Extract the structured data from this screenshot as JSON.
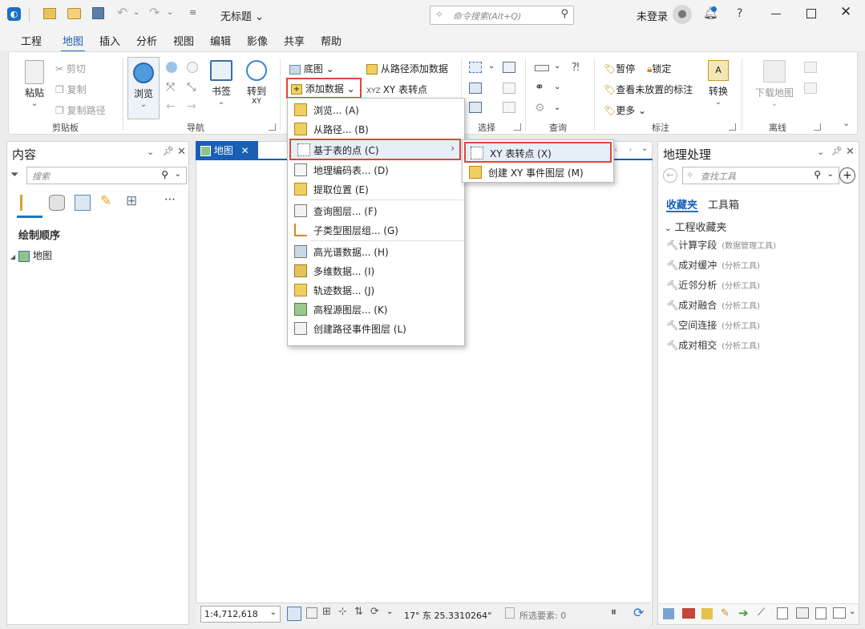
{
  "titlebar": {
    "doc_title": "无标题",
    "search_placeholder": "命令搜索(Alt+Q)",
    "user_label": "未登录",
    "help": "?"
  },
  "ribbon_tabs": [
    "工程",
    "地图",
    "插入",
    "分析",
    "视图",
    "编辑",
    "影像",
    "共享",
    "帮助"
  ],
  "active_tab": "地图",
  "ribbon": {
    "clipboard": {
      "paste": "粘贴",
      "cut": "剪切",
      "copy": "复制",
      "copy_path": "复制路径",
      "label": "剪贴板"
    },
    "navigate": {
      "explore": "浏览",
      "bookmarks": "书签",
      "goto": "转到",
      "goto_sub": "XY",
      "label": "导航"
    },
    "layer": {
      "basemap": "底图",
      "add_data": "添加数据",
      "add_from_path": "从路径添加数据",
      "xy_to_point": "XY 表转点"
    },
    "selection": {
      "label": "选择"
    },
    "inquiry": {
      "label": "查询"
    },
    "labeling": {
      "pause": "暂停",
      "lock": "锁定",
      "unplaced": "查看未放置的标注",
      "more": "更多",
      "convert": "转换",
      "label": "标注"
    },
    "offline": {
      "download": "下载地图",
      "label": "离线"
    }
  },
  "contents": {
    "title": "内容",
    "search_placeholder": "搜索",
    "draw_order": "绘制顺序",
    "map_item": "地图"
  },
  "map_view": {
    "tab_label": "地图"
  },
  "add_data_menu": {
    "items": [
      {
        "label": "浏览...  (A)",
        "icon": "browse-icon"
      },
      {
        "label": "从路径...  (B)",
        "icon": "add-from-path-icon"
      },
      {
        "label": "基于表的点  (C)",
        "icon": "points-from-table-icon",
        "submenu": true
      },
      {
        "label": "地理编码表...  (D)",
        "icon": "geocode-table-icon"
      },
      {
        "label": "提取位置  (E)",
        "icon": "extract-locations-icon"
      },
      {
        "label": "查询图层...  (F)",
        "icon": "query-layer-icon"
      },
      {
        "label": "子类型图层组...  (G)",
        "icon": "subtype-group-icon"
      },
      {
        "label": "高光谱数据...  (H)",
        "icon": "hyperspectral-icon"
      },
      {
        "label": "多维数据...  (I)",
        "icon": "multidimensional-icon"
      },
      {
        "label": "轨迹数据...  (J)",
        "icon": "trajectory-icon"
      },
      {
        "label": "高程源图层...  (K)",
        "icon": "elevation-source-icon"
      },
      {
        "label": "创建路径事件图层  (L)",
        "icon": "route-event-icon"
      }
    ]
  },
  "points_submenu": {
    "items": [
      {
        "label": "XY 表转点  (X)",
        "icon": "xy-table-to-point-icon"
      },
      {
        "label": "创建 XY 事件图层  (M)",
        "icon": "xy-event-layer-icon"
      }
    ]
  },
  "geoprocessing": {
    "title": "地理处理",
    "search_placeholder": "查找工具",
    "tab_favorites": "收藏夹",
    "tab_toolboxes": "工具箱",
    "section": "工程收藏夹",
    "tools": [
      {
        "name": "计算字段",
        "box": "(数据管理工具)"
      },
      {
        "name": "成对缓冲",
        "box": "(分析工具)"
      },
      {
        "name": "近邻分析",
        "box": "(分析工具)"
      },
      {
        "name": "成对融合",
        "box": "(分析工具)"
      },
      {
        "name": "空间连接",
        "box": "(分析工具)"
      },
      {
        "name": "成对相交",
        "box": "(分析工具)"
      }
    ]
  },
  "statusbar": {
    "scale": "1:4,712,618",
    "coordinates": "17° 东  25.3310264°",
    "selected_features": "所选要素: 0"
  },
  "colors": {
    "accent": "#1a73c8",
    "highlight_border": "#e0453b",
    "map_tab": "#1a5fb4"
  }
}
